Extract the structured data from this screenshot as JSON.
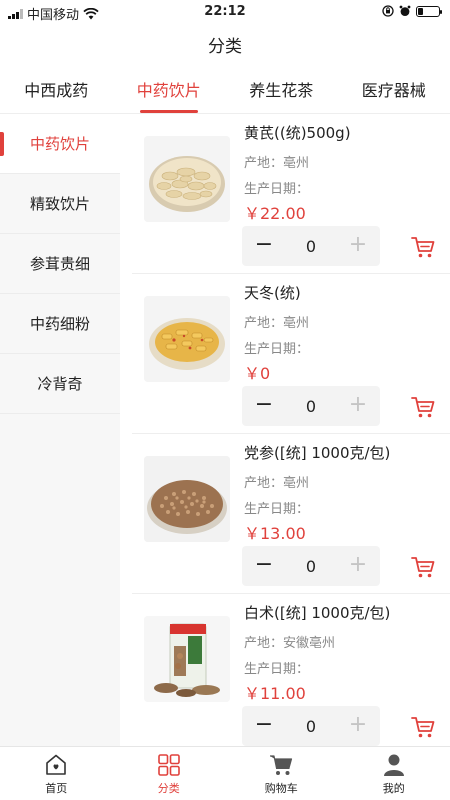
{
  "status_bar": {
    "carrier": "中国移动",
    "time": "22:12"
  },
  "nav": {
    "title": "分类"
  },
  "top_tabs": [
    {
      "label": "中西成药",
      "active": false
    },
    {
      "label": "中药饮片",
      "active": true
    },
    {
      "label": "养生花茶",
      "active": false
    },
    {
      "label": "医疗器械",
      "active": false
    }
  ],
  "sidebar": [
    {
      "label": "中药饮片",
      "active": true
    },
    {
      "label": "精致饮片",
      "active": false
    },
    {
      "label": "参茸贵细",
      "active": false
    },
    {
      "label": "中药细粉",
      "active": false
    },
    {
      "label": "冷背奇",
      "active": false
    }
  ],
  "products": [
    {
      "name": "黄芪((统)500g)",
      "origin": "产地：亳州",
      "date_label": "生产日期：",
      "price": "￥22.00",
      "qty": "0",
      "thumb": "slices"
    },
    {
      "name": "天冬(统)",
      "origin": "产地：亳州",
      "date_label": "生产日期：",
      "price": "￥0",
      "qty": "0",
      "thumb": "yellow"
    },
    {
      "name": "党参([统] 1000克/包)",
      "origin": "产地：亳州",
      "date_label": "生产日期：",
      "price": "￥13.00",
      "qty": "0",
      "thumb": "brown"
    },
    {
      "name": "白术([统] 1000克/包)",
      "origin": "产地：安徽亳州",
      "date_label": "生产日期：",
      "price": "￥11.00",
      "qty": "0",
      "thumb": "package"
    }
  ],
  "bottom_tabs": [
    {
      "label": "首页",
      "icon": "home-icon",
      "active": false
    },
    {
      "label": "分类",
      "icon": "category-icon",
      "active": true
    },
    {
      "label": "购物车",
      "icon": "cart-icon",
      "active": false
    },
    {
      "label": "我的",
      "icon": "user-icon",
      "active": false
    }
  ],
  "colors": {
    "accent": "#e0413c",
    "sidebar_bg": "#f7f7f7",
    "stepper_bg": "#f3f3f3"
  }
}
